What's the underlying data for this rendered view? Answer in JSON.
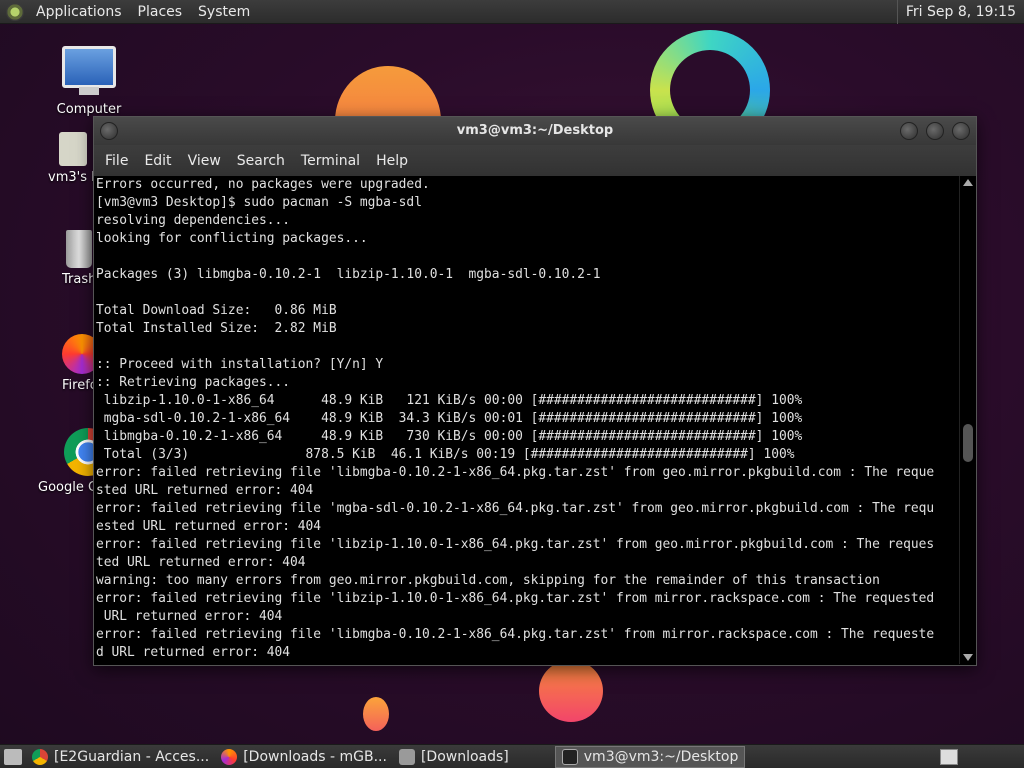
{
  "top_panel": {
    "menus": [
      "Applications",
      "Places",
      "System"
    ],
    "clock": "Fri Sep  8, 19:15"
  },
  "desktop_icons": [
    {
      "label": "Computer"
    },
    {
      "label": "vm3's Home"
    },
    {
      "label": "Trash"
    },
    {
      "label": "Firefox"
    },
    {
      "label": "Google Chrome"
    }
  ],
  "window": {
    "title": "vm3@vm3:~/Desktop",
    "menu": [
      "File",
      "Edit",
      "View",
      "Search",
      "Terminal",
      "Help"
    ]
  },
  "terminal_lines": [
    "Errors occurred, no packages were upgraded.",
    "[vm3@vm3 Desktop]$ sudo pacman -S mgba-sdl",
    "resolving dependencies...",
    "looking for conflicting packages...",
    "",
    "Packages (3) libmgba-0.10.2-1  libzip-1.10.0-1  mgba-sdl-0.10.2-1",
    "",
    "Total Download Size:   0.86 MiB",
    "Total Installed Size:  2.82 MiB",
    "",
    ":: Proceed with installation? [Y/n] Y",
    ":: Retrieving packages...",
    " libzip-1.10.0-1-x86_64      48.9 KiB   121 KiB/s 00:00 [############################] 100%",
    " mgba-sdl-0.10.2-1-x86_64    48.9 KiB  34.3 KiB/s 00:01 [############################] 100%",
    " libmgba-0.10.2-1-x86_64     48.9 KiB   730 KiB/s 00:00 [############################] 100%",
    " Total (3/3)               878.5 KiB  46.1 KiB/s 00:19 [############################] 100%",
    "error: failed retrieving file 'libmgba-0.10.2-1-x86_64.pkg.tar.zst' from geo.mirror.pkgbuild.com : The reque",
    "sted URL returned error: 404",
    "error: failed retrieving file 'mgba-sdl-0.10.2-1-x86_64.pkg.tar.zst' from geo.mirror.pkgbuild.com : The requ",
    "ested URL returned error: 404",
    "error: failed retrieving file 'libzip-1.10.0-1-x86_64.pkg.tar.zst' from geo.mirror.pkgbuild.com : The reques",
    "ted URL returned error: 404",
    "warning: too many errors from geo.mirror.pkgbuild.com, skipping for the remainder of this transaction",
    "error: failed retrieving file 'libzip-1.10.0-1-x86_64.pkg.tar.zst' from mirror.rackspace.com : The requested",
    " URL returned error: 404",
    "error: failed retrieving file 'libmgba-0.10.2-1-x86_64.pkg.tar.zst' from mirror.rackspace.com : The requeste",
    "d URL returned error: 404"
  ],
  "taskbar": {
    "tasks": [
      {
        "label": "[E2Guardian - Acces...",
        "icon": "chrome-icon",
        "active": false
      },
      {
        "label": "[Downloads - mGB...",
        "icon": "firefox-icon",
        "active": false
      },
      {
        "label": "[Downloads]",
        "icon": "folder-icon",
        "active": false
      },
      {
        "label": "vm3@vm3:~/Desktop",
        "icon": "terminal-icon",
        "active": true
      }
    ]
  },
  "colors": {
    "desktop_bg": "#2a0c2a",
    "terminal_bg": "#000000",
    "terminal_fg": "#e0e0e0"
  }
}
